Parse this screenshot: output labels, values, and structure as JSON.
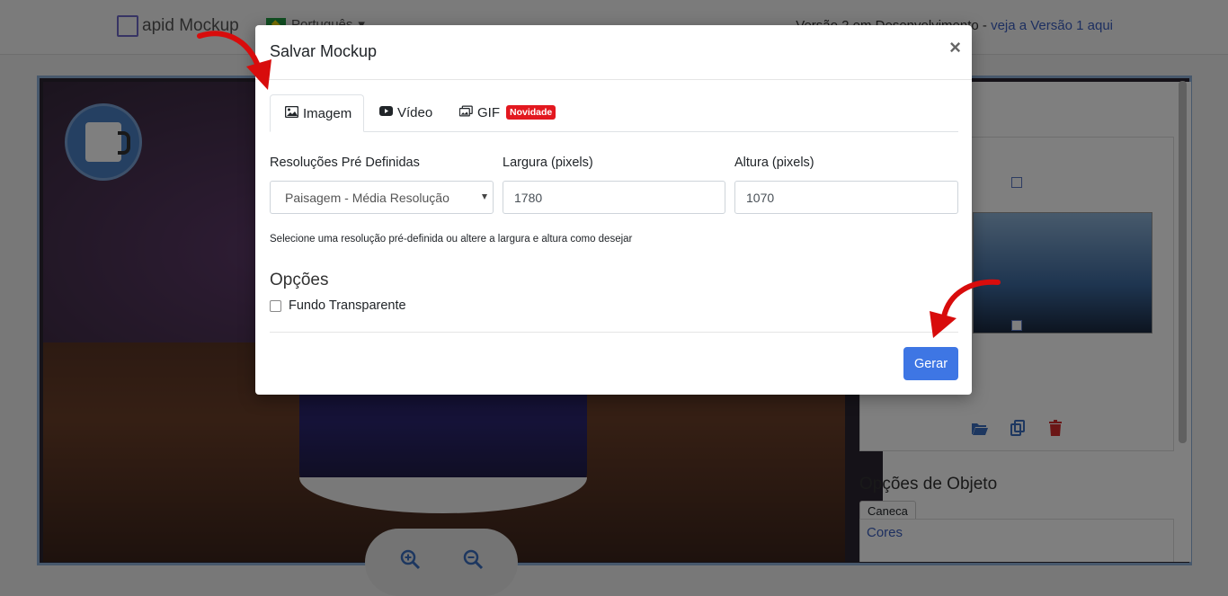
{
  "app": {
    "logo_text": "apid Mockup",
    "language": "Português",
    "version_text": "Versão 2 em Desenvolvimento - ",
    "version_link": "veja a Versão 1 aqui"
  },
  "side_panel": {
    "object_options_title": "Opções de Objeto",
    "object_tab": "Caneca",
    "colors_label": "Cores"
  },
  "modal": {
    "title": "Salvar Mockup",
    "close_label": "×",
    "tabs": [
      {
        "label": "Imagem",
        "icon": "image-icon",
        "active": true
      },
      {
        "label": "Vídeo",
        "icon": "youtube-icon",
        "active": false
      },
      {
        "label": "GIF",
        "icon": "images-icon",
        "active": false,
        "badge": "Novidade"
      }
    ],
    "fields": {
      "preset": {
        "label": "Resoluções Pré Definidas",
        "value": "Paisagem - Média Resolução"
      },
      "width": {
        "label": "Largura (pixels)",
        "value": "1780"
      },
      "height": {
        "label": "Altura (pixels)",
        "value": "1070"
      }
    },
    "help_text": "Selecione uma resolução pré-definida ou altere a largura e altura como desejar",
    "options_title": "Opções",
    "transparent_label": "Fundo Transparente",
    "transparent_checked": false,
    "generate_button": "Gerar"
  },
  "colors": {
    "accent": "#3e76e4",
    "badge": "#e3181f",
    "annotation_arrow": "#d80c0c"
  }
}
